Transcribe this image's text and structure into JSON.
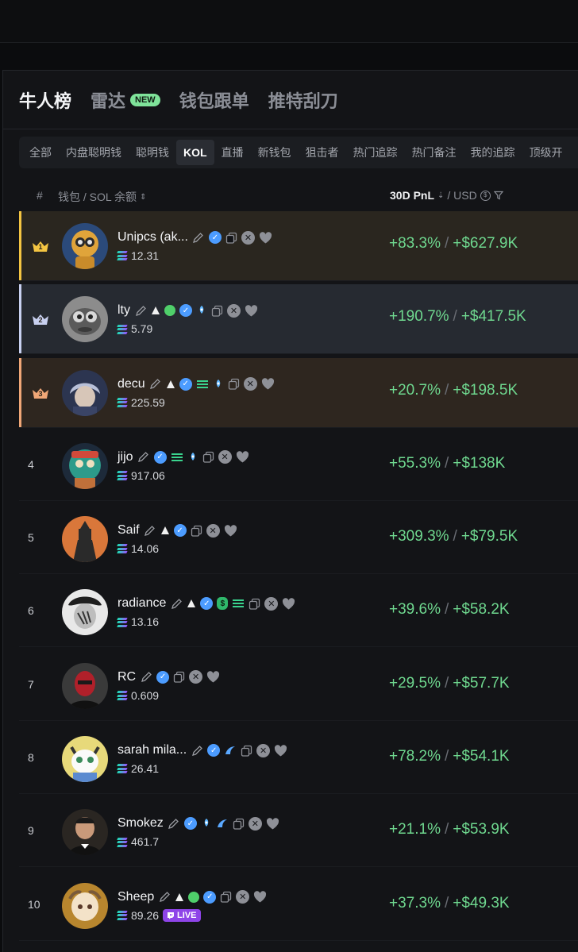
{
  "header": {
    "tabs": [
      {
        "label": "牛人榜",
        "active": true
      },
      {
        "label": "雷达",
        "badge": "NEW"
      },
      {
        "label": "钱包跟单"
      },
      {
        "label": "推特刮刀"
      }
    ]
  },
  "filters": [
    "全部",
    "内盘聪明钱",
    "聪明钱",
    "KOL",
    "直播",
    "新钱包",
    "狙击者",
    "热门追踪",
    "热门备注",
    "我的追踪",
    "顶级开"
  ],
  "active_filter": "KOL",
  "columns": {
    "num": "#",
    "wallet": "钱包 / SOL 余额",
    "pnl": "30D PnL",
    "currency": "/ USD"
  },
  "colors": {
    "accent_green": "#6fd88f",
    "gold": "#f4c542",
    "silver": "#c8d0f0",
    "bronze": "#f0a777",
    "verify_blue": "#4c9cff"
  },
  "rows": [
    {
      "rank": "1",
      "name": "Unipcs (ak...",
      "sol": "12.31",
      "pct": "+83.3%",
      "usd": "+$627.9K"
    },
    {
      "rank": "2",
      "name": "lty",
      "sol": "5.79",
      "pct": "+190.7%",
      "usd": "+$417.5K"
    },
    {
      "rank": "3",
      "name": "decu",
      "sol": "225.59",
      "pct": "+20.7%",
      "usd": "+$198.5K"
    },
    {
      "rank": "4",
      "name": "jijo",
      "sol": "917.06",
      "pct": "+55.3%",
      "usd": "+$138K"
    },
    {
      "rank": "5",
      "name": "Saif",
      "sol": "14.06",
      "pct": "+309.3%",
      "usd": "+$79.5K"
    },
    {
      "rank": "6",
      "name": "radiance",
      "sol": "13.16",
      "pct": "+39.6%",
      "usd": "+$58.2K"
    },
    {
      "rank": "7",
      "name": "RC",
      "sol": "0.609",
      "pct": "+29.5%",
      "usd": "+$57.7K"
    },
    {
      "rank": "8",
      "name": "sarah mila...",
      "sol": "26.41",
      "pct": "+78.2%",
      "usd": "+$54.1K"
    },
    {
      "rank": "9",
      "name": "Smokez",
      "sol": "461.7",
      "pct": "+21.1%",
      "usd": "+$53.9K"
    },
    {
      "rank": "10",
      "name": "Sheep",
      "sol": "89.26",
      "pct": "+37.3%",
      "usd": "+$49.3K",
      "live": "LIVE"
    }
  ]
}
